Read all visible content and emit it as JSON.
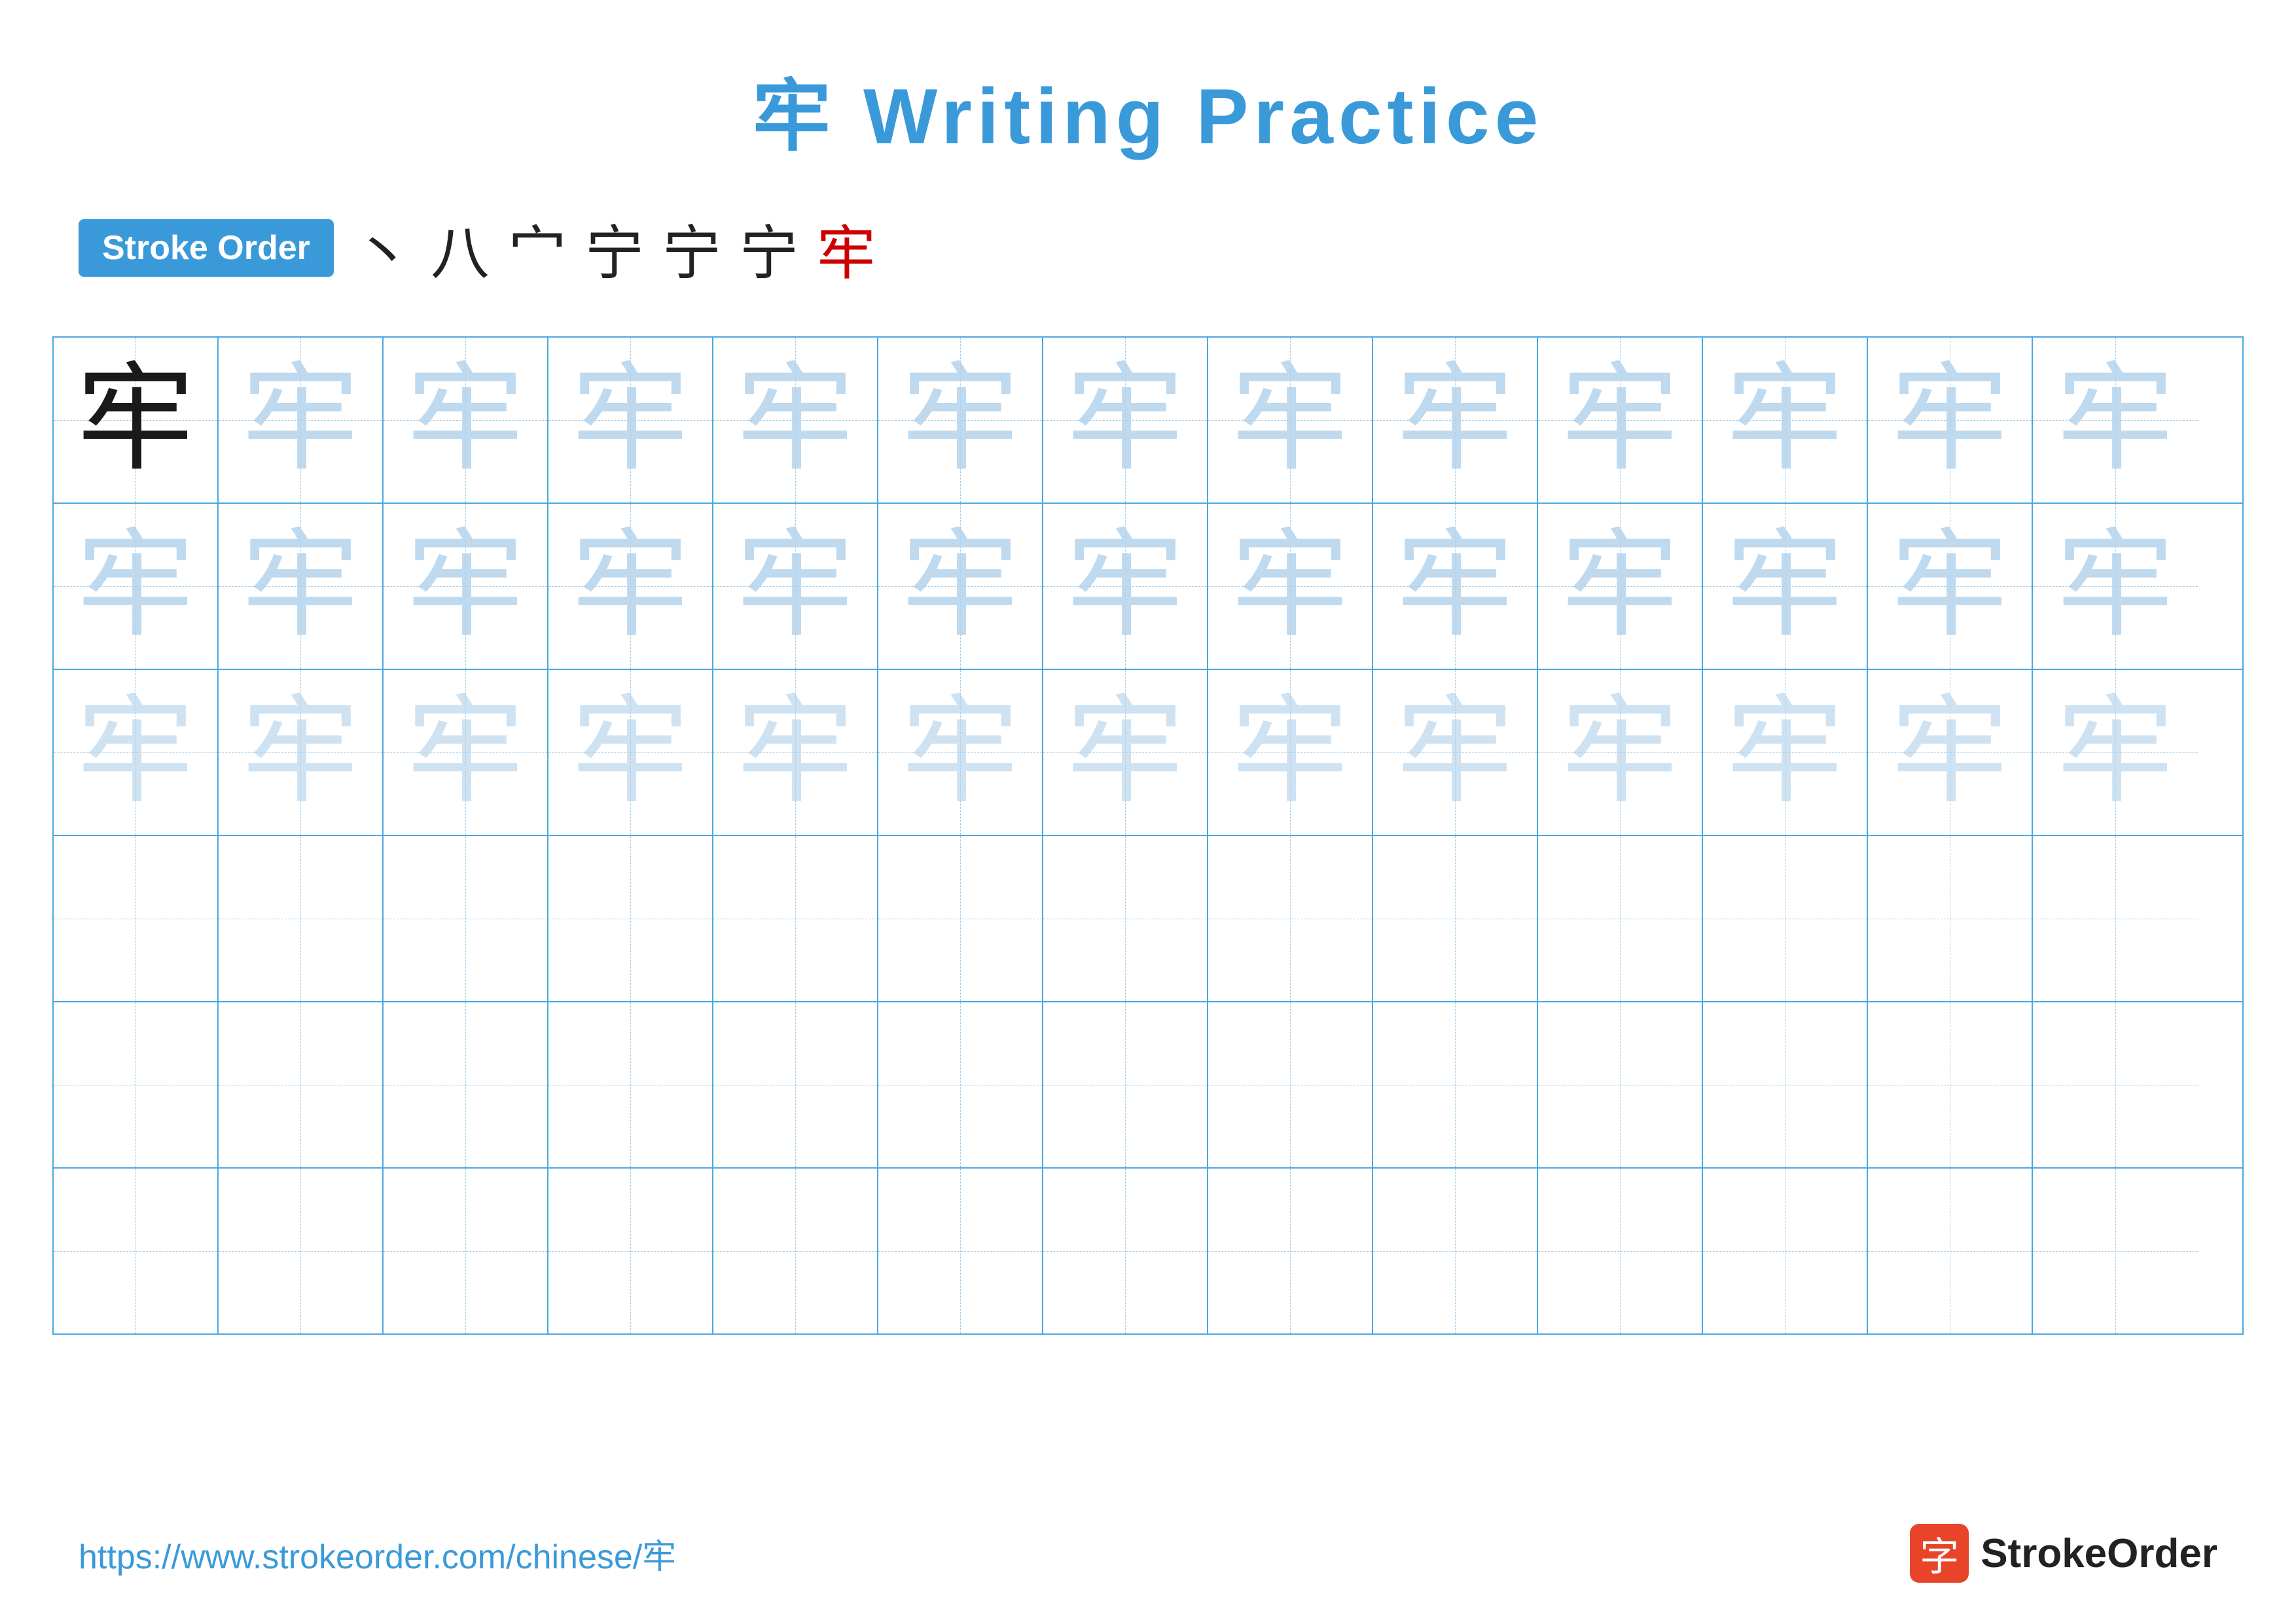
{
  "title": {
    "character": "牢",
    "label": "Writing Practice"
  },
  "stroke_order": {
    "badge_label": "Stroke Order",
    "strokes": [
      "丶",
      "八",
      "宀",
      "宁",
      "宁",
      "宁",
      "牢"
    ],
    "final_stroke_index": 6
  },
  "grid": {
    "rows": 6,
    "cols": 13,
    "character": "牢",
    "row_styles": [
      [
        "dark",
        "light1",
        "light1",
        "light1",
        "light1",
        "light1",
        "light1",
        "light1",
        "light1",
        "light1",
        "light1",
        "light1",
        "light1"
      ],
      [
        "light1",
        "light1",
        "light1",
        "light1",
        "light1",
        "light1",
        "light1",
        "light1",
        "light1",
        "light1",
        "light1",
        "light1",
        "light1"
      ],
      [
        "light2",
        "light2",
        "light2",
        "light2",
        "light2",
        "light2",
        "light2",
        "light2",
        "light2",
        "light2",
        "light2",
        "light2",
        "light2"
      ],
      [
        "empty",
        "empty",
        "empty",
        "empty",
        "empty",
        "empty",
        "empty",
        "empty",
        "empty",
        "empty",
        "empty",
        "empty",
        "empty"
      ],
      [
        "empty",
        "empty",
        "empty",
        "empty",
        "empty",
        "empty",
        "empty",
        "empty",
        "empty",
        "empty",
        "empty",
        "empty",
        "empty"
      ],
      [
        "empty",
        "empty",
        "empty",
        "empty",
        "empty",
        "empty",
        "empty",
        "empty",
        "empty",
        "empty",
        "empty",
        "empty",
        "empty"
      ]
    ]
  },
  "footer": {
    "url": "https://www.strokeorder.com/chinese/牢",
    "logo_char": "字",
    "logo_text": "StrokeOrder"
  }
}
